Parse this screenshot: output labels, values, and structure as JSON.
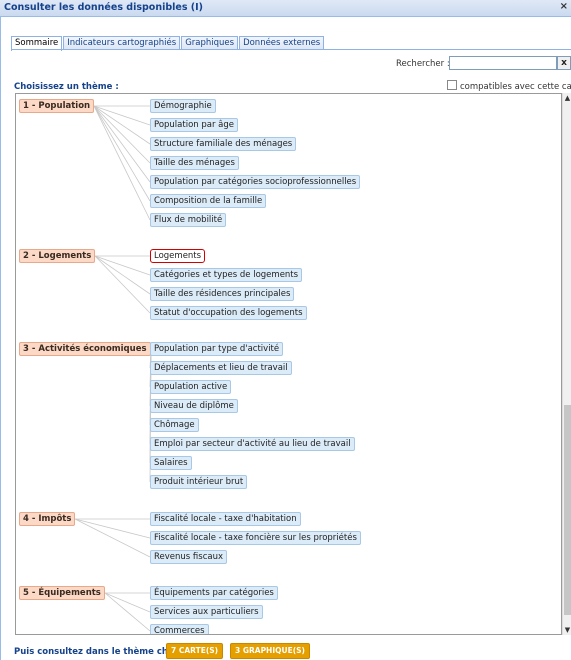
{
  "window": {
    "title": "Consulter les données disponibles (I)",
    "close_label": "×"
  },
  "tabs": [
    "Sommaire",
    "Indicateurs cartographiés",
    "Graphiques",
    "Données externes"
  ],
  "search": {
    "label": "Rechercher :",
    "value": "",
    "clear_label": "x"
  },
  "choose_label": "Choisissez un thème :",
  "compat_label": "compatibles avec cette carte",
  "themes": [
    {
      "label": "1 - Population",
      "indicators": [
        "Démographie",
        "Population par âge",
        "Structure familiale des ménages",
        "Taille des ménages",
        "Population par catégories socioprofessionnelles",
        "Composition de la famille",
        "Flux de mobilité"
      ]
    },
    {
      "label": "2 - Logements",
      "indicators": [
        "Logements",
        "Catégories et types de logements",
        "Taille des résidences principales",
        "Statut d'occupation des logements"
      ]
    },
    {
      "label": "3 - Activités économiques",
      "indicators": [
        "Population par type d'activité",
        "Déplacements et lieu de travail",
        "Population active",
        "Niveau de diplôme",
        "Chômage",
        "Emploi par secteur d'activité au lieu de travail",
        "Salaires",
        "Produit intérieur brut"
      ]
    },
    {
      "label": "4 - Impôts",
      "indicators": [
        "Fiscalité locale - taxe d'habitation",
        "Fiscalité locale - taxe foncière sur les propriétés",
        "Revenus fiscaux"
      ]
    },
    {
      "label": "5 - Équipements",
      "indicators": [
        "Équipements par catégories",
        "Services aux particuliers",
        "Commerces"
      ]
    }
  ],
  "selected_indicator": "Logements",
  "bottom": {
    "label": "Puis consultez dans le thème choisi :",
    "cartes_label": "7 CARTE(S)",
    "graphiques_label": "3 GRAPHIQUE(S)"
  },
  "colors": {
    "theme_bg": "#fbd9c6",
    "indicator_bg": "#dcebf8",
    "accent": "#15428b",
    "button": "#e5a000",
    "selected_border": "#d40000"
  }
}
